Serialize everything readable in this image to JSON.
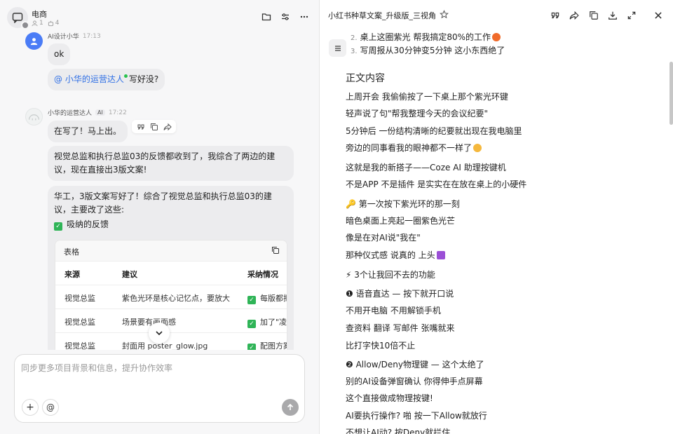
{
  "group": {
    "name": "电商",
    "members": "1",
    "bots": "4"
  },
  "messages": {
    "m1": {
      "sender": "AI设计小华",
      "time": "17:13",
      "text": "ok"
    },
    "m2": {
      "mention": "@ 小华的运营达人",
      "text": "写好没?"
    },
    "m3": {
      "sender": "小华的运营达人",
      "badge": "AI",
      "time": "17:22",
      "text": "在写了！马上出。"
    },
    "m4": {
      "text": "视觉总监和执行总监03的反馈都收到了，我综合了两边的建议，现在直接出3版文案!"
    },
    "m5": {
      "text": "华工，3版文案写好了！综合了视觉总监和执行总监03的建议，主要改了这些:",
      "check_label": "吸纳的反馈"
    }
  },
  "table": {
    "title": "表格",
    "headers": [
      "来源",
      "建议",
      "采纳情况"
    ],
    "rows": [
      [
        "视觉总监",
        "紫色光环是核心记忆点，要放大",
        "每版都把"
      ],
      [
        "视觉总监",
        "场景要有画面感",
        "加了\"凌晨"
      ],
      [
        "视觉总监",
        "封面用 poster_glow.jpg",
        "配图方案"
      ]
    ]
  },
  "composer": {
    "placeholder": "同步更多项目背景和信息，提升协作效率",
    "plus": "+",
    "at": "@"
  },
  "doc": {
    "title": "小红书种草文案_升级版_三视角",
    "list": [
      {
        "n": "2.",
        "text": "桌上这圈紫光 帮我搞定80%的工作"
      },
      {
        "n": "3.",
        "text": "写周报从30分钟变5分钟 这小东西绝了"
      }
    ],
    "heading": "正文内容",
    "lines": [
      "上周开会 我偷偷按了一下桌上那个紫光环键",
      "轻声说了句\"帮我整理今天的会议纪要\"",
      "5分钟后 一份结构清晰的纪要就出现在我电脑里",
      "旁边的同事看我的眼神都不一样了",
      "这就是我的新搭子——Coze AI 助理按键机",
      "不是APP 不是插件 是实实在在放在桌上的小硬件",
      "🔑 第一次按下紫光环的那一刻",
      "暗色桌面上亮起一圈紫色光芒",
      "像是在对AI说\"我在\"",
      "那种仪式感 说真的 上头",
      "⚡ 3个让我回不去的功能",
      "❶ 语音直达 — 按下就开口说",
      "不用开电脑 不用解锁手机",
      "查资料 翻译 写邮件 张嘴就来",
      "比打字快10倍不止",
      "❷ Allow/Deny物理键 — 这个太绝了",
      "别的AI设备弹窗确认 你得伸手点屏幕",
      "这个直接做成物理按键!",
      "AI要执行操作? 啪 按一下Allow就放行",
      "不想让AI动? 按Deny就拦住"
    ]
  }
}
